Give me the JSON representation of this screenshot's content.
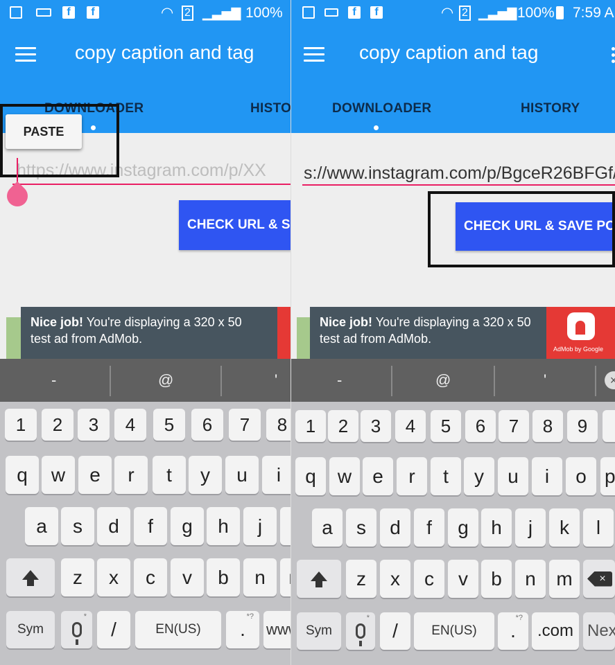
{
  "status_bar": {
    "battery": "100%",
    "time": "7:59 A",
    "sim_slot": "2"
  },
  "app": {
    "title": "copy caption and tag"
  },
  "tabs": [
    {
      "label": "DOWNLOADER"
    },
    {
      "label": "HISTORY"
    }
  ],
  "left_panel": {
    "history_tab_partial": "HISTO",
    "paste_label": "PASTE",
    "url_placeholder": "https://www.instagram.com/p/XX",
    "check_label": "CHECK URL & S"
  },
  "right_panel": {
    "url_value": "s://www.instagram.com/p/BgceR26BFGf/",
    "check_label": "CHECK URL & SAVE POS"
  },
  "ad": {
    "headline": "Nice job!",
    "body_line1": "You're displaying a 320 x 50",
    "body_line2": "test ad from AdMob.",
    "brand": "AdMob by Google"
  },
  "keyboard": {
    "suggestions": [
      "-",
      "@",
      "'"
    ],
    "numbers": [
      "1",
      "2",
      "3",
      "4",
      "5",
      "6",
      "7",
      "8",
      "9"
    ],
    "row_q": [
      "q",
      "w",
      "e",
      "r",
      "t",
      "y",
      "u",
      "i",
      "o",
      "p"
    ],
    "row_a": [
      "a",
      "s",
      "d",
      "f",
      "g",
      "h",
      "j",
      "k",
      "l"
    ],
    "row_z": [
      "z",
      "x",
      "c",
      "v",
      "b",
      "n",
      "m"
    ],
    "sym": "Sym",
    "slash": "/",
    "lang": "EN(US)",
    "period": ".",
    "period_hint": "*?",
    "mic_hint": "*",
    "www": "www.",
    "dotcom": ".com",
    "next": "Next"
  }
}
